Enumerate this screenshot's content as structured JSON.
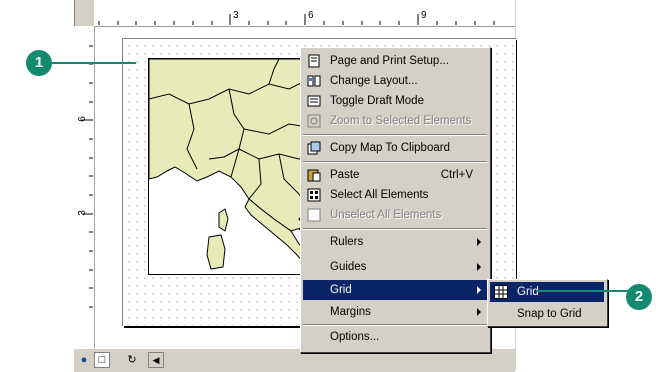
{
  "ruler": {
    "h_ticks": [
      "3",
      "6",
      "9"
    ],
    "v_ticks": [
      "6",
      "3"
    ]
  },
  "context_menu": {
    "items": [
      {
        "label": "Page and Print Setup...",
        "icon": "page-setup-icon",
        "enabled": true
      },
      {
        "label": "Change Layout...",
        "icon": "change-layout-icon",
        "enabled": true
      },
      {
        "label": "Toggle Draft Mode",
        "icon": "draft-mode-icon",
        "enabled": true
      },
      {
        "label": "Zoom to Selected Elements",
        "icon": "zoom-selected-icon",
        "enabled": false
      },
      {
        "label": "Copy Map To Clipboard",
        "icon": "copy-map-icon",
        "enabled": true
      },
      {
        "label": "Paste",
        "shortcut": "Ctrl+V",
        "icon": "paste-icon",
        "enabled": true
      },
      {
        "label": "Select All Elements",
        "icon": "select-all-icon",
        "enabled": true
      },
      {
        "label": "Unselect All Elements",
        "icon": "unselect-all-icon",
        "enabled": false
      },
      {
        "label": "Rulers",
        "submenu": true,
        "enabled": true
      },
      {
        "label": "Guides",
        "submenu": true,
        "enabled": true
      },
      {
        "label": "Grid",
        "submenu": true,
        "enabled": true,
        "selected": true
      },
      {
        "label": "Margins",
        "submenu": true,
        "enabled": true
      },
      {
        "label": "Options...",
        "enabled": true
      }
    ]
  },
  "submenu": {
    "items": [
      {
        "label": "Grid",
        "icon": "grid-icon",
        "selected": true
      },
      {
        "label": "Snap to Grid",
        "selected": false
      }
    ]
  },
  "callouts": [
    "1",
    "2"
  ],
  "colors": {
    "callout": "#138a6e",
    "selection": "#0a246a",
    "land": "#e6ebb8",
    "menu_bg": "#d4d0c8"
  }
}
